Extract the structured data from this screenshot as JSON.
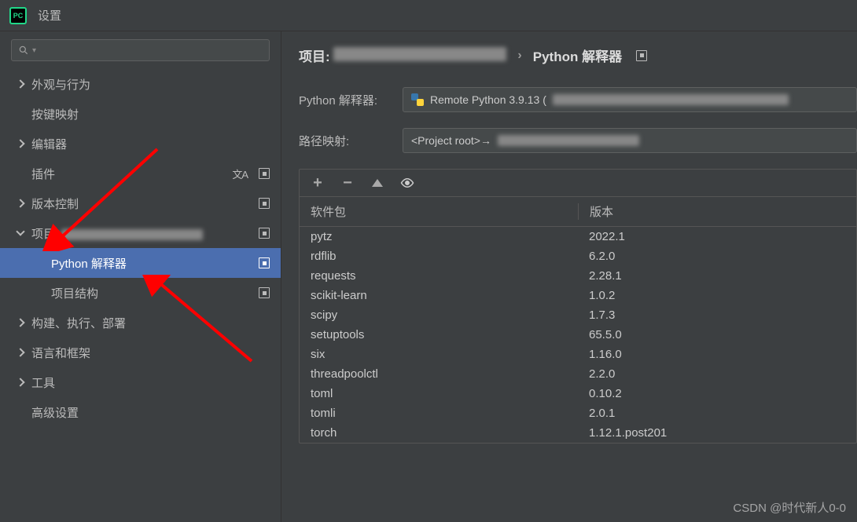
{
  "window": {
    "app_icon_text": "PC",
    "title": "设置"
  },
  "sidebar": {
    "search_placeholder": "",
    "items": [
      {
        "label": "外观与行为",
        "expandable": true,
        "expanded": false,
        "has_badge": false
      },
      {
        "label": "按键映射",
        "expandable": false,
        "has_badge": false
      },
      {
        "label": "编辑器",
        "expandable": true,
        "expanded": false,
        "has_badge": false
      },
      {
        "label": "插件",
        "expandable": false,
        "has_badge": true,
        "has_translate": true
      },
      {
        "label": "版本控制",
        "expandable": true,
        "expanded": false,
        "has_badge": true
      },
      {
        "label": "项目:",
        "expandable": true,
        "expanded": true,
        "has_badge": true,
        "has_blur": true
      },
      {
        "label": "Python 解释器",
        "expandable": false,
        "has_badge": true,
        "child": true,
        "selected": true
      },
      {
        "label": "项目结构",
        "expandable": false,
        "has_badge": true,
        "child": true
      },
      {
        "label": "构建、执行、部署",
        "expandable": true,
        "expanded": false,
        "has_badge": false
      },
      {
        "label": "语言和框架",
        "expandable": true,
        "expanded": false,
        "has_badge": false
      },
      {
        "label": "工具",
        "expandable": true,
        "expanded": false,
        "has_badge": false
      },
      {
        "label": "高级设置",
        "expandable": false,
        "has_badge": false
      }
    ]
  },
  "breadcrumb": {
    "project_prefix": "项目:",
    "separator": "›",
    "current": "Python 解释器"
  },
  "interpreter": {
    "label": "Python 解释器:",
    "value": "Remote Python 3.9.13 ("
  },
  "path_mapping": {
    "label": "路径映射:",
    "value": "<Project root>→"
  },
  "packages": {
    "header_name": "软件包",
    "header_version": "版本",
    "rows": [
      {
        "name": "pytz",
        "version": "2022.1"
      },
      {
        "name": "rdflib",
        "version": "6.2.0"
      },
      {
        "name": "requests",
        "version": "2.28.1"
      },
      {
        "name": "scikit-learn",
        "version": "1.0.2"
      },
      {
        "name": "scipy",
        "version": "1.7.3"
      },
      {
        "name": "setuptools",
        "version": "65.5.0"
      },
      {
        "name": "six",
        "version": "1.16.0"
      },
      {
        "name": "threadpoolctl",
        "version": "2.2.0"
      },
      {
        "name": "toml",
        "version": "0.10.2"
      },
      {
        "name": "tomli",
        "version": "2.0.1"
      },
      {
        "name": "torch",
        "version": "1.12.1.post201"
      }
    ]
  },
  "watermark": "CSDN @时代新人0-0"
}
